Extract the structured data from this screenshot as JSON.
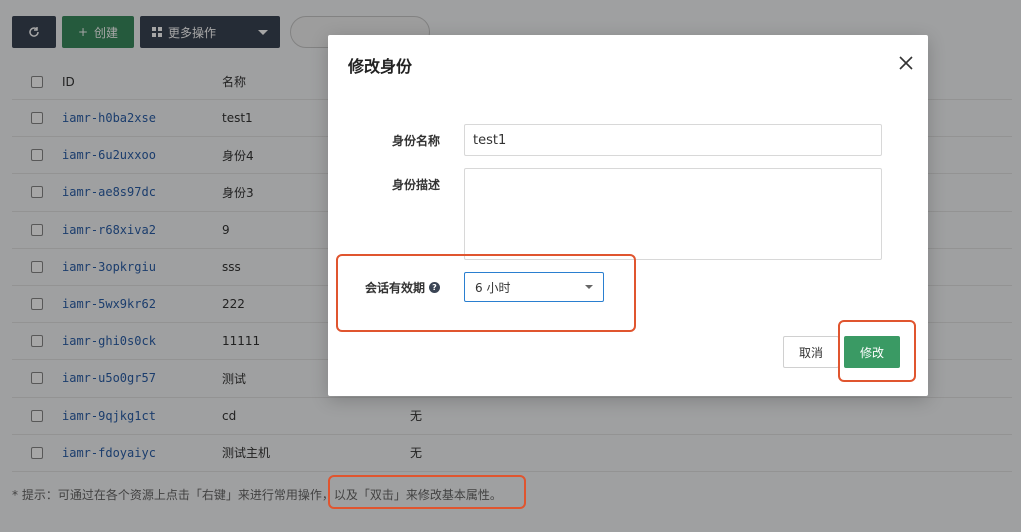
{
  "toolbar": {
    "refresh_icon": "refresh-icon",
    "create_label": "创建",
    "more_label": "更多操作"
  },
  "table": {
    "headers": {
      "id": "ID",
      "name": "名称"
    },
    "rows": [
      {
        "id": "iamr-h0ba2xse",
        "name": "test1",
        "desc": ""
      },
      {
        "id": "iamr-6u2uxxoo",
        "name": "身份4",
        "desc": ""
      },
      {
        "id": "iamr-ae8s97dc",
        "name": "身份3",
        "desc": ""
      },
      {
        "id": "iamr-r68xiva2",
        "name": "9",
        "desc": ""
      },
      {
        "id": "iamr-3opkrgiu",
        "name": "sss",
        "desc": ""
      },
      {
        "id": "iamr-5wx9kr62",
        "name": "222",
        "desc": ""
      },
      {
        "id": "iamr-ghi0s0ck",
        "name": "11111",
        "desc": ""
      },
      {
        "id": "iamr-u5o0gr57",
        "name": "测试",
        "desc": ""
      },
      {
        "id": "iamr-9qjkg1ct",
        "name": "cd",
        "desc": "无"
      },
      {
        "id": "iamr-fdoyaiyc",
        "name": "测试主机",
        "desc": "无"
      }
    ]
  },
  "hint": "* 提示：可通过在各个资源上点击「右键」来进行常用操作，以及「双击」来修改基本属性。",
  "modal": {
    "title": "修改身份",
    "name_label": "身份名称",
    "name_value": "test1",
    "desc_label": "身份描述",
    "desc_value": "",
    "session_label": "会话有效期",
    "session_value": "6 小时",
    "cancel_label": "取消",
    "submit_label": "修改"
  },
  "colors": {
    "primary_green": "#3a9a64",
    "highlight_red": "#e0552f",
    "link_blue": "#2a5ea8"
  }
}
